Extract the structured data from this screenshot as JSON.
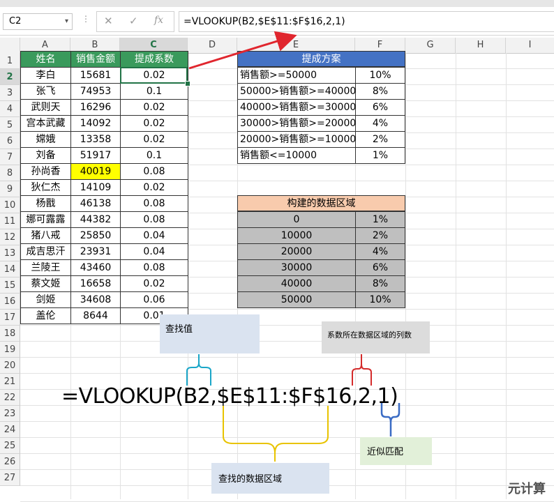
{
  "formula_bar": {
    "name_box": "C2",
    "cancel_icon": "✕",
    "confirm_icon": "✓",
    "fx_icon": "fx",
    "formula": "=VLOOKUP(B2,$E$11:$F$16,2,1)"
  },
  "columns": [
    "A",
    "B",
    "C",
    "D",
    "E",
    "F",
    "G",
    "H",
    "I"
  ],
  "rows": [
    "1",
    "2",
    "3",
    "4",
    "5",
    "6",
    "7",
    "8",
    "9",
    "10",
    "11",
    "12",
    "13",
    "14",
    "15",
    "16",
    "17",
    "18",
    "19",
    "20",
    "21",
    "22",
    "23",
    "24",
    "25",
    "26",
    "27"
  ],
  "main_table": {
    "headers": [
      "姓名",
      "销售金额",
      "提成系数"
    ],
    "rows": [
      [
        "李白",
        "15681",
        "0.02"
      ],
      [
        "张飞",
        "74953",
        "0.1"
      ],
      [
        "武则天",
        "16296",
        "0.02"
      ],
      [
        "宫本武藏",
        "14092",
        "0.02"
      ],
      [
        "嫦娥",
        "13358",
        "0.02"
      ],
      [
        "刘备",
        "51917",
        "0.1"
      ],
      [
        "孙尚香",
        "40019",
        "0.08"
      ],
      [
        "狄仁杰",
        "14109",
        "0.02"
      ],
      [
        "杨戬",
        "46138",
        "0.08"
      ],
      [
        "娜可露露",
        "44382",
        "0.08"
      ],
      [
        "猪八戒",
        "25850",
        "0.04"
      ],
      [
        "成吉思汗",
        "23931",
        "0.04"
      ],
      [
        "兰陵王",
        "43460",
        "0.08"
      ],
      [
        "蔡文姬",
        "16658",
        "0.02"
      ],
      [
        "剑姬",
        "34608",
        "0.06"
      ],
      [
        "盖伦",
        "8644",
        "0.01"
      ]
    ],
    "highlight_color": "#ffff00",
    "header_color": "#3a9a5c"
  },
  "scheme_table": {
    "title": "提成方案",
    "rows": [
      [
        "销售额>=50000",
        "10%"
      ],
      [
        "50000>销售额>=40000",
        "8%"
      ],
      [
        "40000>销售额>=30000",
        "6%"
      ],
      [
        "30000>销售额>=20000",
        "4%"
      ],
      [
        "20000>销售额>=10000",
        "2%"
      ],
      [
        "销售额<=10000",
        "1%"
      ]
    ],
    "header_color": "#4472c4"
  },
  "lookup_table": {
    "title": "构建的数据区域",
    "rows": [
      [
        "0",
        "1%"
      ],
      [
        "10000",
        "2%"
      ],
      [
        "20000",
        "4%"
      ],
      [
        "30000",
        "6%"
      ],
      [
        "40000",
        "8%"
      ],
      [
        "50000",
        "10%"
      ]
    ],
    "header_color": "#f8cbad",
    "fill_color": "#bfbfbf"
  },
  "annotations": {
    "formula": "=VLOOKUP(B2,$E$11:$F$16,2,1)",
    "lookup_value": "查找值",
    "column_index": "系数所在数据区域的列数",
    "approx_match": "近似匹配",
    "lookup_range": "查找的数据区域"
  },
  "watermark": "元计算"
}
